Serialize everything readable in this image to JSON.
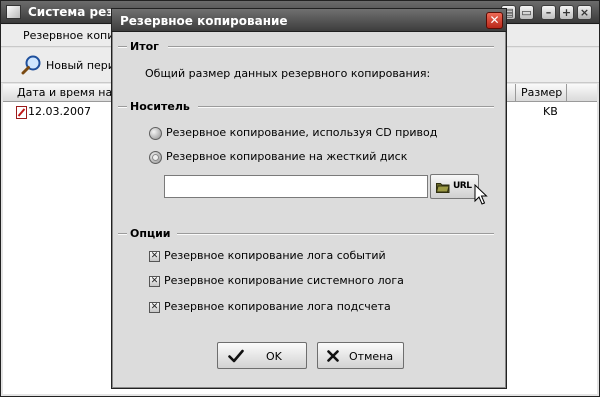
{
  "app": {
    "title": "Система резервного копирования",
    "menu": {
      "item": "Резервное копирование"
    },
    "toolbar": {
      "new_period": "Новый период"
    },
    "table": {
      "headers": [
        "Дата и время на...",
        "Размер"
      ],
      "rows": [
        {
          "date": "12.03.2007",
          "size": "KB"
        }
      ]
    }
  },
  "dialog": {
    "title": "Резервное копирование",
    "sections": {
      "summary": {
        "title": "Итог",
        "text": "Общий размер данных резервного копирования:"
      },
      "media": {
        "title": "Носитель",
        "options": [
          {
            "label": "Резервное копирование, используя CD привод",
            "selected": false
          },
          {
            "label": "Резервное копирование на жесткий диск",
            "selected": true
          }
        ],
        "path_value": "",
        "url_button_label": "URL"
      },
      "options": {
        "title": "Опции",
        "items": [
          {
            "label": "Резервное копирование лога событий",
            "checked": true
          },
          {
            "label": "Резервное копирование системного лога",
            "checked": true
          },
          {
            "label": "Резервное копирование лога подсчета",
            "checked": true
          }
        ]
      }
    },
    "buttons": {
      "ok": "OK",
      "cancel": "Отмена"
    }
  }
}
